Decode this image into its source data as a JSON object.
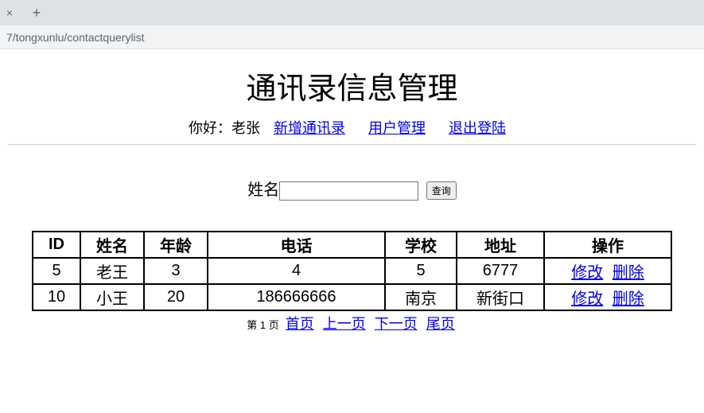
{
  "browser": {
    "url_fragment": "7/tongxunlu/contactquerylist"
  },
  "page_title": "通讯录信息管理",
  "nav": {
    "greeting_prefix": "你好：",
    "username": "老张",
    "add_link": "新增通讯录",
    "user_mgmt_link": "用户管理",
    "logout_link": "退出登陆"
  },
  "search": {
    "label": "姓名",
    "value": "",
    "button": "查询"
  },
  "table": {
    "headers": [
      "ID",
      "姓名",
      "年龄",
      "电话",
      "学校",
      "地址",
      "操作"
    ],
    "rows": [
      {
        "id": "5",
        "name": "老王",
        "age": "3",
        "phone": "4",
        "school": "5",
        "address": "6777"
      },
      {
        "id": "10",
        "name": "小王",
        "age": "20",
        "phone": "186666666",
        "school": "南京",
        "address": "新街口"
      }
    ],
    "action_edit": "修改",
    "action_delete": "删除"
  },
  "pager": {
    "info": "第 1 页",
    "first": "首页",
    "prev": "上一页",
    "next": "下一页",
    "last": "尾页"
  }
}
